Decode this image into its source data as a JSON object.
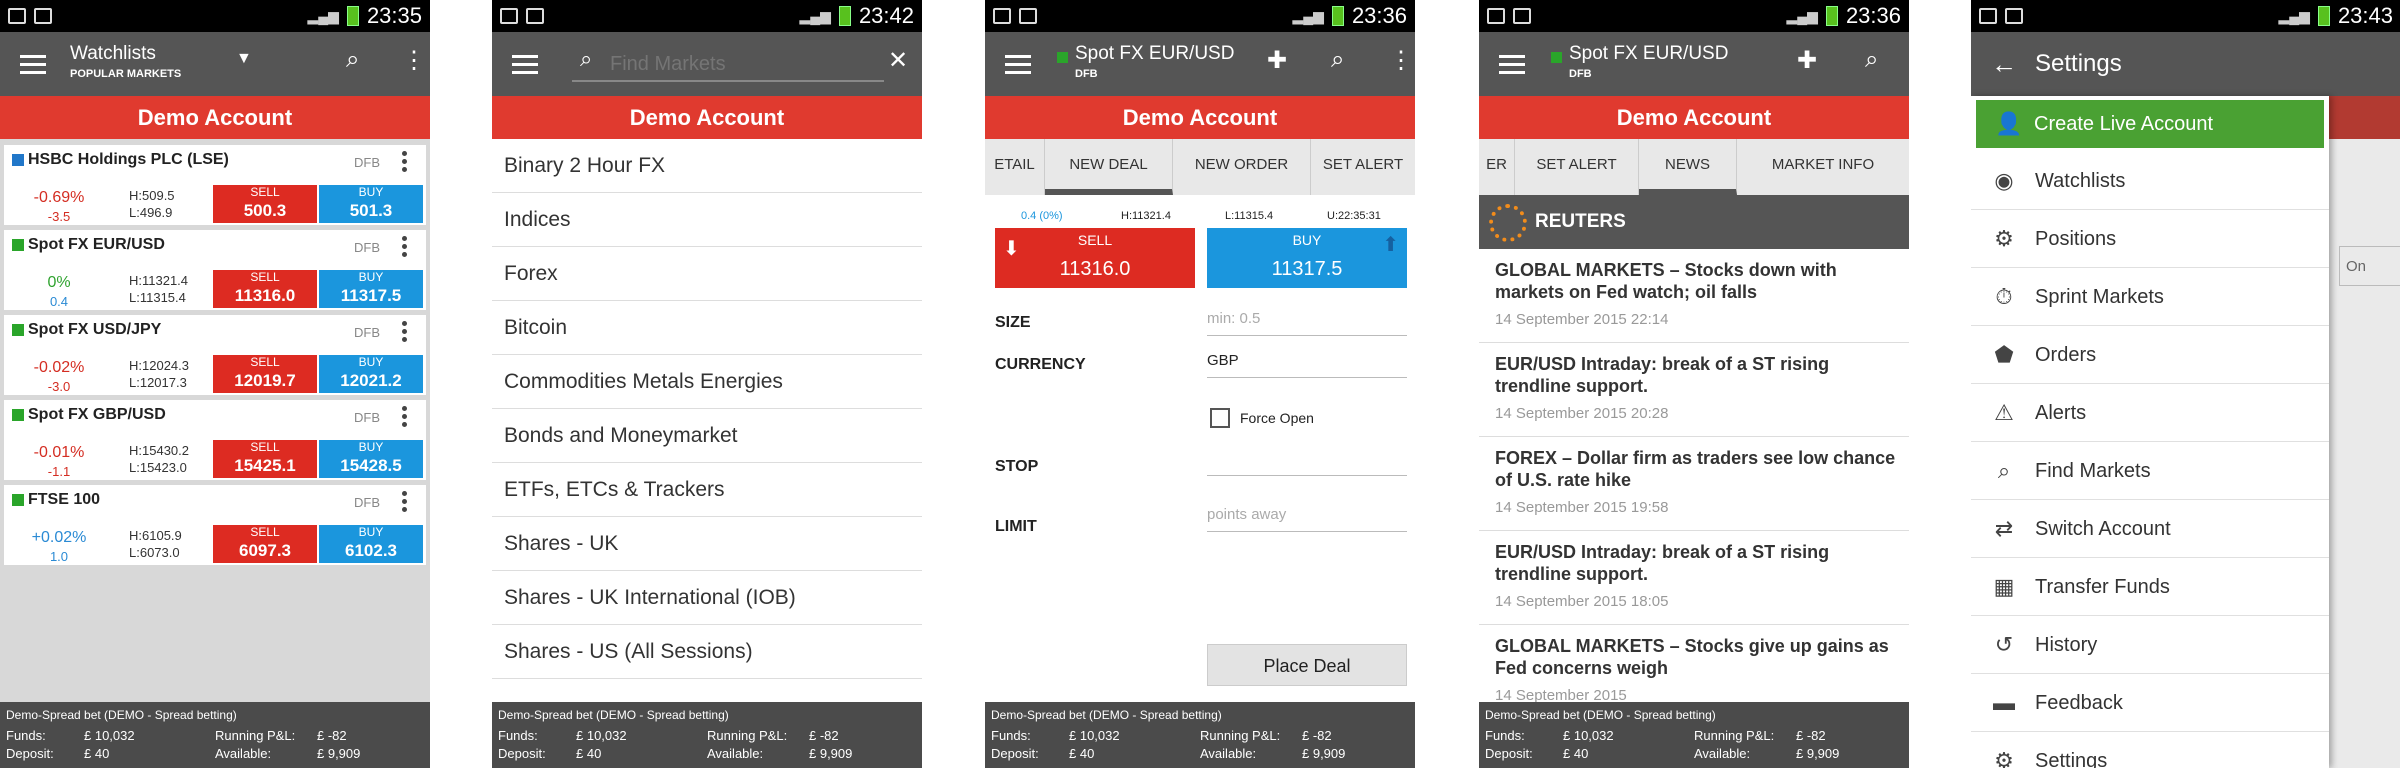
{
  "status_times": [
    "23:35",
    "23:42",
    "23:36",
    "23:36",
    "23:43"
  ],
  "account_banner": "Demo Account",
  "footer": {
    "mode": "Demo-Spread bet (DEMO - Spread betting)",
    "funds_label": "Funds:",
    "funds_value": "£ 10,032",
    "pnl_label": "Running P&L:",
    "pnl_value": "£ -82",
    "deposit_label": "Deposit:",
    "deposit_value": "£ 40",
    "available_label": "Available:",
    "available_value": "£ 9,909"
  },
  "colors": {
    "accent_red": "#e03a2f",
    "sell": "#dd2b22",
    "buy": "#1b96dd",
    "appbar": "#555555",
    "live_green": "#4aa133"
  },
  "screen1": {
    "title": "Watchlists",
    "subtitle": "POPULAR MARKETS",
    "markets": [
      {
        "name": "HSBC Holdings PLC (LSE)",
        "type": "DFB",
        "change_pct": "-0.69%",
        "change": "-3.5",
        "high": "H:509.5",
        "low": "L:496.9",
        "sell_label": "SELL",
        "sell": "500.3",
        "buy_label": "BUY",
        "buy": "501.3"
      },
      {
        "name": "Spot FX EUR/USD",
        "type": "DFB",
        "change_pct": "0%",
        "change": "0.4",
        "high": "H:11321.4",
        "low": "L:11315.4",
        "sell_label": "SELL",
        "sell": "11316.0",
        "buy_label": "BUY",
        "buy": "11317.5"
      },
      {
        "name": "Spot FX USD/JPY",
        "type": "DFB",
        "change_pct": "-0.02%",
        "change": "-3.0",
        "high": "H:12024.3",
        "low": "L:12017.3",
        "sell_label": "SELL",
        "sell": "12019.7",
        "buy_label": "BUY",
        "buy": "12021.2"
      },
      {
        "name": "Spot FX GBP/USD",
        "type": "DFB",
        "change_pct": "-0.01%",
        "change": "-1.1",
        "high": "H:15430.2",
        "low": "L:15423.0",
        "sell_label": "SELL",
        "sell": "15425.1",
        "buy_label": "BUY",
        "buy": "15428.5"
      },
      {
        "name": "FTSE 100",
        "type": "DFB",
        "change_pct": "+0.02%",
        "change": "1.0",
        "high": "H:6105.9",
        "low": "L:6073.0",
        "sell_label": "SELL",
        "sell": "6097.3",
        "buy_label": "BUY",
        "buy": "6102.3"
      }
    ]
  },
  "screen2": {
    "search_placeholder": "Find Markets",
    "categories": [
      "Binary 2 Hour FX",
      "Indices",
      "Forex",
      "Bitcoin",
      "Commodities Metals Energies",
      "Bonds and Moneymarket",
      "ETFs, ETCs & Trackers",
      "Shares - UK",
      "Shares - UK International (IOB)",
      "Shares - US (All Sessions)"
    ]
  },
  "screen3": {
    "market": "Spot FX EUR/USD",
    "market_type": "DFB",
    "tabs": [
      "ETAIL",
      "NEW DEAL",
      "NEW ORDER",
      "SET ALERT"
    ],
    "info_change": "0.4 (0%)",
    "info_high": "H:11321.4",
    "info_low": "L:11315.4",
    "info_time": "U:22:35:31",
    "sell_label": "SELL",
    "sell": "11316.0",
    "buy_label": "BUY",
    "buy": "11317.5",
    "size_label": "SIZE",
    "size_placeholder": "min: 0.5",
    "currency_label": "CURRENCY",
    "currency_value": "GBP",
    "force_open": "Force Open",
    "stop_label": "STOP",
    "limit_label": "LIMIT",
    "limit_placeholder": "points away",
    "place_deal": "Place Deal"
  },
  "screen4": {
    "market": "Spot FX EUR/USD",
    "market_type": "DFB",
    "tabs": [
      "ER",
      "SET ALERT",
      "NEWS",
      "MARKET INFO"
    ],
    "source": "REUTERS",
    "news": [
      {
        "headline": "GLOBAL MARKETS – Stocks down with markets on Fed watch; oil falls",
        "date": "14 September 2015 22:14"
      },
      {
        "headline": "EUR/USD Intraday: break of a ST rising trendline support.",
        "date": "14 September 2015 20:28"
      },
      {
        "headline": "FOREX – Dollar firm as traders see low chance of U.S. rate hike",
        "date": "14 September 2015 19:58"
      },
      {
        "headline": "EUR/USD Intraday: break of a ST rising trendline support.",
        "date": "14 September 2015 18:05"
      },
      {
        "headline": "GLOBAL MARKETS – Stocks give up gains as Fed concerns weigh",
        "date": "14 September 2015"
      }
    ]
  },
  "screen5": {
    "title": "Settings",
    "behind_on": "On",
    "items": [
      {
        "label": "Create Live Account",
        "icon": "person-plus-icon",
        "glyph": "👤"
      },
      {
        "label": "Watchlists",
        "icon": "eye-icon",
        "glyph": "◉"
      },
      {
        "label": "Positions",
        "icon": "positions-icon",
        "glyph": "⚙"
      },
      {
        "label": "Sprint Markets",
        "icon": "stopwatch-icon",
        "glyph": "⏱"
      },
      {
        "label": "Orders",
        "icon": "tag-icon",
        "glyph": "⬟"
      },
      {
        "label": "Alerts",
        "icon": "warning-icon",
        "glyph": "⚠"
      },
      {
        "label": "Find Markets",
        "icon": "search-icon",
        "glyph": "⌕"
      },
      {
        "label": "Switch Account",
        "icon": "switch-icon",
        "glyph": "⇄"
      },
      {
        "label": "Transfer Funds",
        "icon": "transfer-icon",
        "glyph": "▦"
      },
      {
        "label": "History",
        "icon": "history-icon",
        "glyph": "↺"
      },
      {
        "label": "Feedback",
        "icon": "feedback-icon",
        "glyph": "▬"
      },
      {
        "label": "Settings",
        "icon": "gear-icon",
        "glyph": "⚙"
      }
    ]
  }
}
